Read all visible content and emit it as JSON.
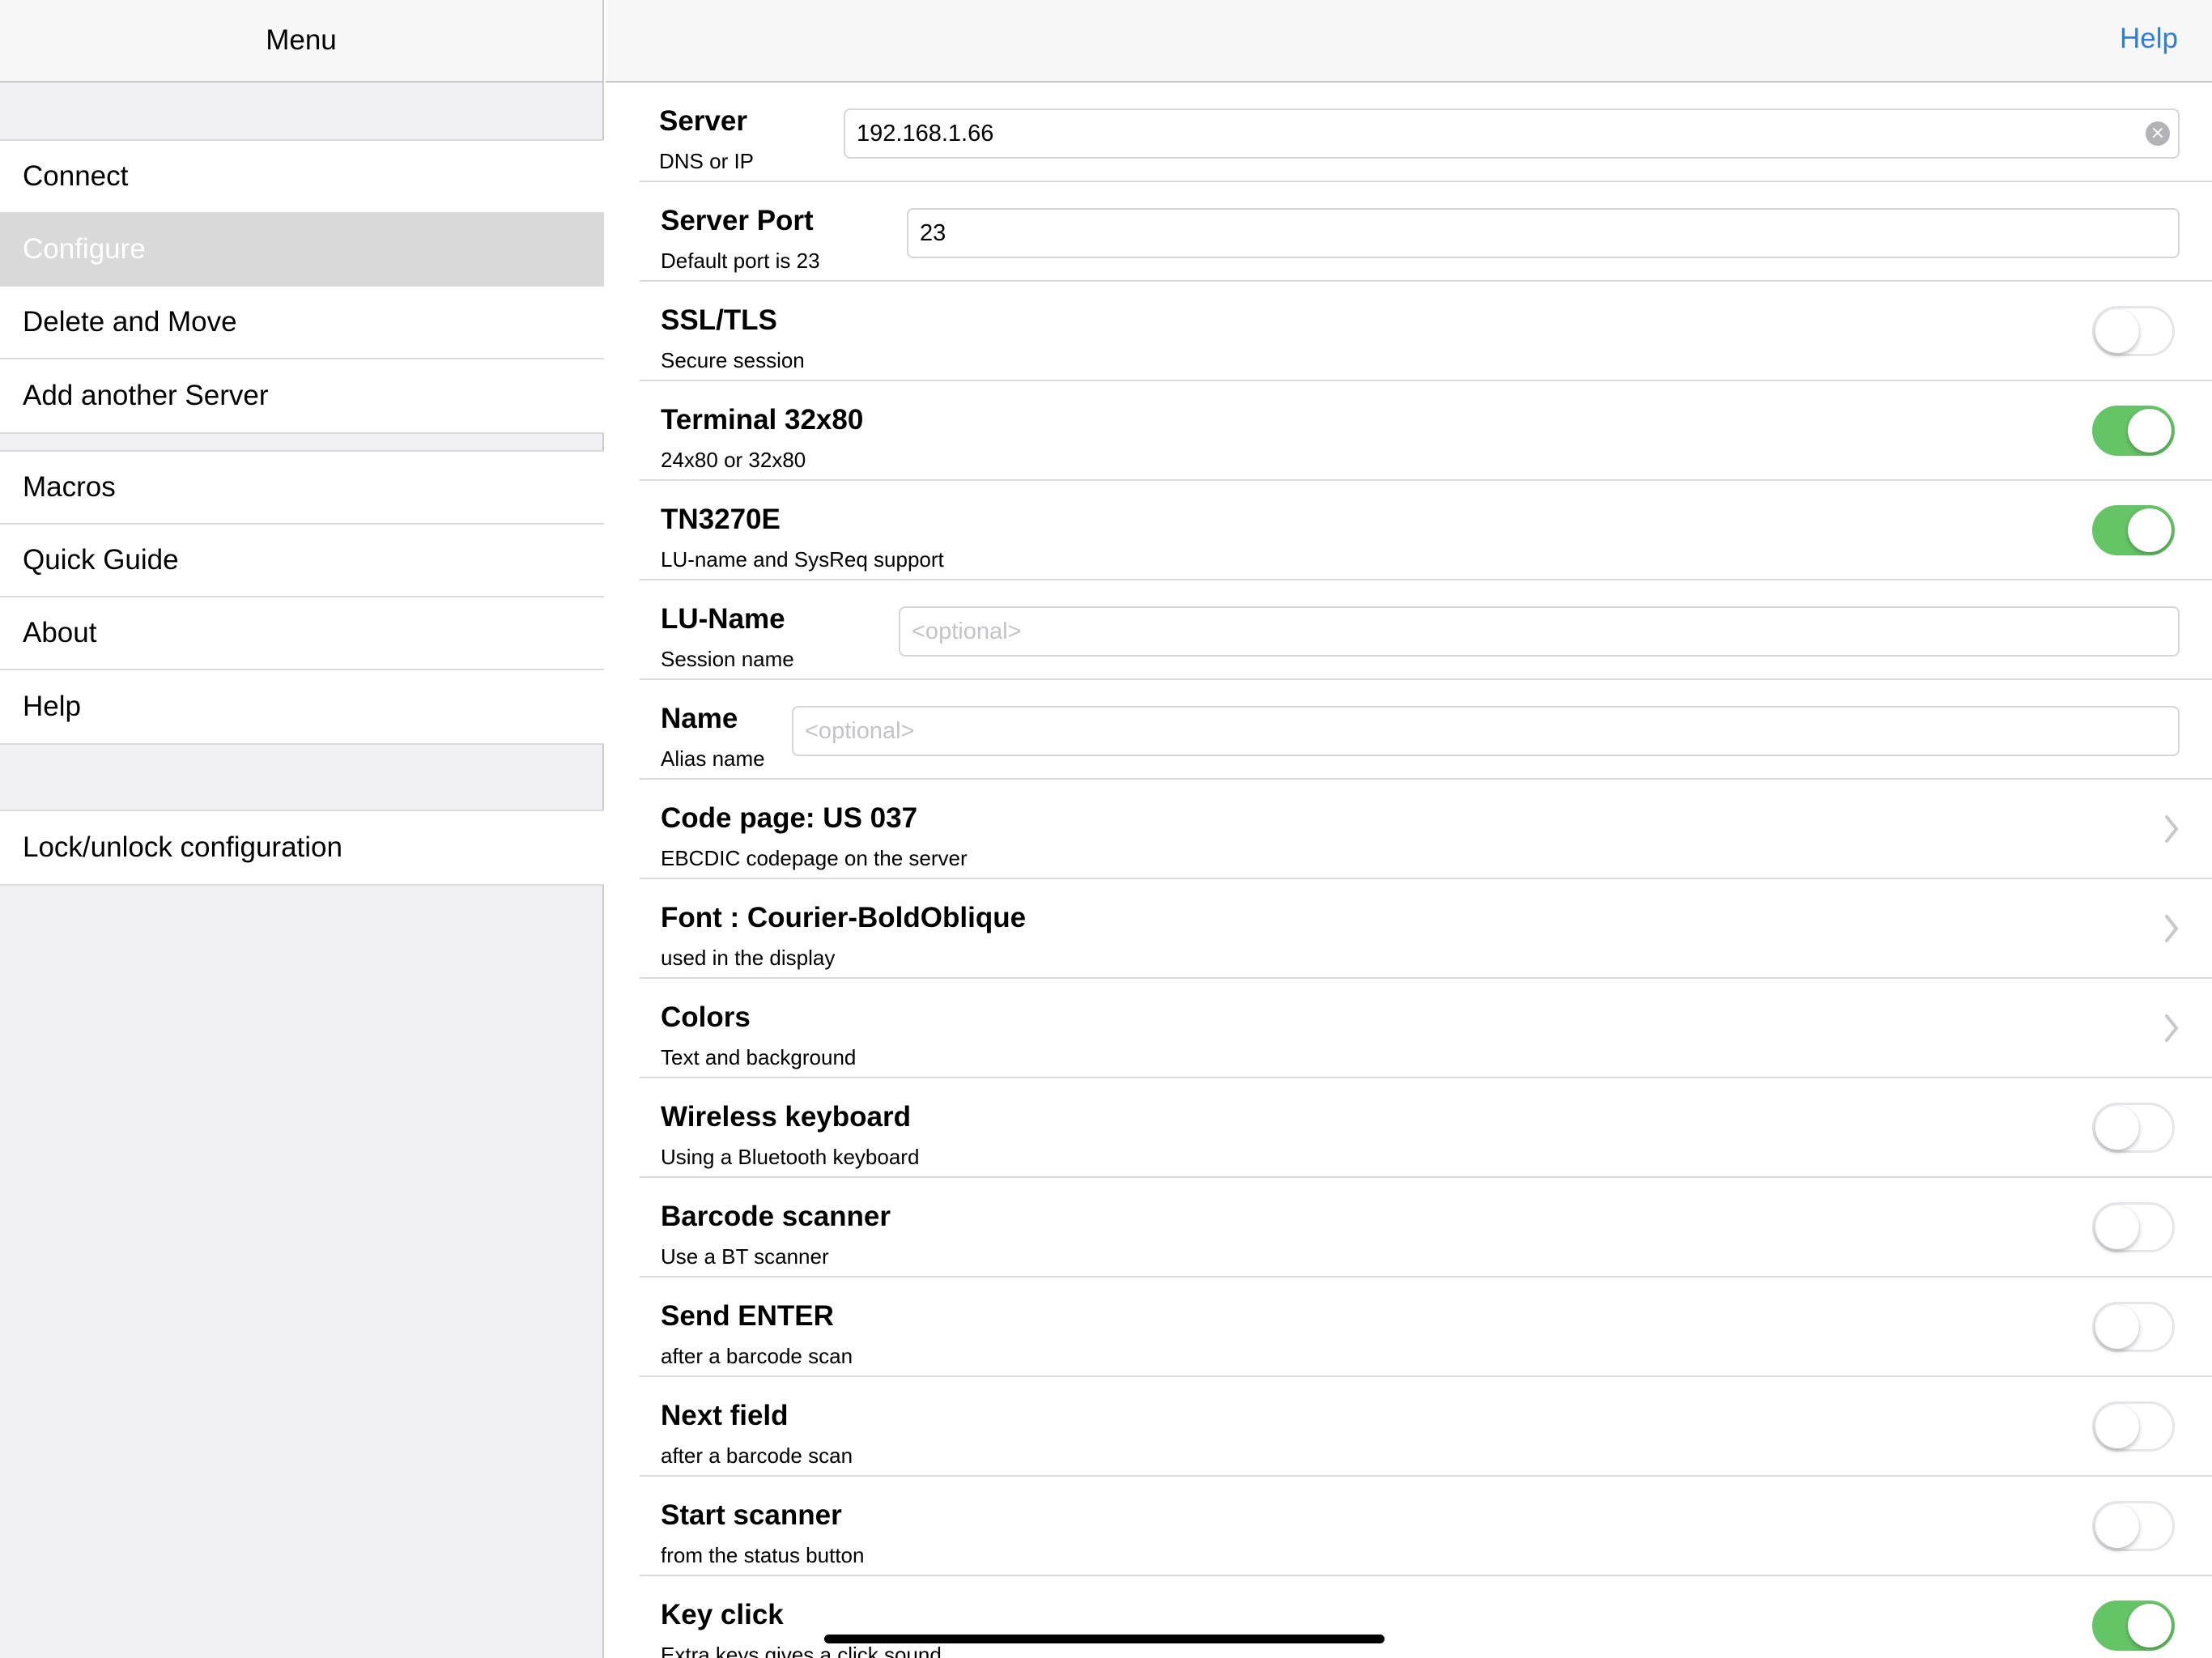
{
  "sidebar": {
    "title": "Menu",
    "groups": [
      {
        "items": [
          {
            "label": "Connect",
            "selected": false
          },
          {
            "label": "Configure",
            "selected": true
          },
          {
            "label": "Delete and Move",
            "selected": false
          },
          {
            "label": "Add another Server",
            "selected": false
          }
        ]
      },
      {
        "items": [
          {
            "label": "Macros",
            "selected": false
          },
          {
            "label": "Quick Guide",
            "selected": false
          },
          {
            "label": "About",
            "selected": false
          },
          {
            "label": "Help",
            "selected": false
          }
        ]
      },
      {
        "items": [
          {
            "label": "Lock/unlock configuration",
            "selected": false
          }
        ]
      }
    ]
  },
  "detail": {
    "help_label": "Help",
    "rows": [
      {
        "title": "Server",
        "subtitle": "DNS or IP",
        "control": "text",
        "value": "192.168.1.66",
        "placeholder": "",
        "clear": true
      },
      {
        "title": "Server Port",
        "subtitle": "Default port is 23",
        "control": "text",
        "value": "23",
        "placeholder": ""
      },
      {
        "title": "SSL/TLS",
        "subtitle": "Secure session",
        "control": "toggle",
        "on": false
      },
      {
        "title": "Terminal 32x80",
        "subtitle": "24x80 or 32x80",
        "control": "toggle",
        "on": true
      },
      {
        "title": "TN3270E",
        "subtitle": "LU-name and SysReq support",
        "control": "toggle",
        "on": true
      },
      {
        "title": "LU-Name",
        "subtitle": "Session name",
        "control": "text",
        "value": "",
        "placeholder": "<optional>"
      },
      {
        "title": "Name",
        "subtitle": "Alias name",
        "control": "text",
        "value": "",
        "placeholder": "<optional>"
      },
      {
        "title": "Code page: US  037",
        "subtitle": "EBCDIC codepage on the server",
        "control": "chevron"
      },
      {
        "title": "Font : Courier-BoldOblique",
        "subtitle": "used in the display",
        "control": "chevron"
      },
      {
        "title": "Colors",
        "subtitle": "Text and background",
        "control": "chevron"
      },
      {
        "title": "Wireless keyboard",
        "subtitle": "Using a Bluetooth keyboard",
        "control": "toggle",
        "on": false
      },
      {
        "title": "Barcode scanner",
        "subtitle": "Use a BT scanner",
        "control": "toggle",
        "on": false
      },
      {
        "title": "Send ENTER",
        "subtitle": "after a barcode scan",
        "control": "toggle",
        "on": false
      },
      {
        "title": "Next field",
        "subtitle": "after a barcode scan",
        "control": "toggle",
        "on": false
      },
      {
        "title": "Start scanner",
        "subtitle": "from the status button",
        "control": "toggle",
        "on": false
      },
      {
        "title": "Key click",
        "subtitle": "Extra keys gives a click sound",
        "control": "toggle",
        "on": true
      }
    ]
  },
  "colors": {
    "accent": "#2f7de1",
    "toggle_on": "#65c466",
    "sidebar_bg": "#efeff4",
    "selected_bg": "#d9d9d9"
  }
}
